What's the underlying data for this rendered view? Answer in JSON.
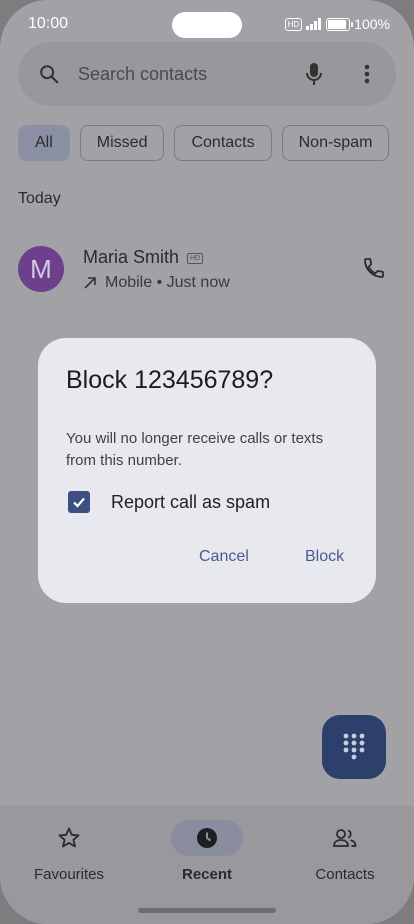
{
  "status_bar": {
    "time": "10:00",
    "hd": "HD",
    "battery": "100%",
    "battery_level": 1.0
  },
  "search": {
    "placeholder": "Search contacts",
    "icons": [
      "search-icon",
      "mic-icon",
      "more-vert-icon"
    ]
  },
  "filters": [
    {
      "label": "All",
      "active": true
    },
    {
      "label": "Missed",
      "active": false
    },
    {
      "label": "Contacts",
      "active": false
    },
    {
      "label": "Non-spam",
      "active": false
    }
  ],
  "section_header": "Today",
  "call": {
    "avatar_letter": "M",
    "avatar_color": "#6e3f8d",
    "name": "Maria Smith",
    "hd": "HD",
    "detail": "Mobile • Just now",
    "icons": [
      "outgoing-call-icon",
      "phone-icon"
    ]
  },
  "dialog": {
    "title": "Block 123456789?",
    "body": "You will no longer receive calls or texts from this number.",
    "checkbox_label": "Report call as spam",
    "checkbox_checked": true,
    "cancel": "Cancel",
    "confirm": "Block"
  },
  "nav": {
    "items": [
      {
        "label": "Favourites",
        "icon": "star-icon",
        "active": false
      },
      {
        "label": "Recent",
        "icon": "clock-icon",
        "active": true
      },
      {
        "label": "Contacts",
        "icon": "people-icon",
        "active": false
      }
    ]
  },
  "colors": {
    "accent": "#3d4e82",
    "fab": "#2d3f6b",
    "dialog_bg": "#e8e8ef",
    "scrim": "#a2a2a6"
  }
}
